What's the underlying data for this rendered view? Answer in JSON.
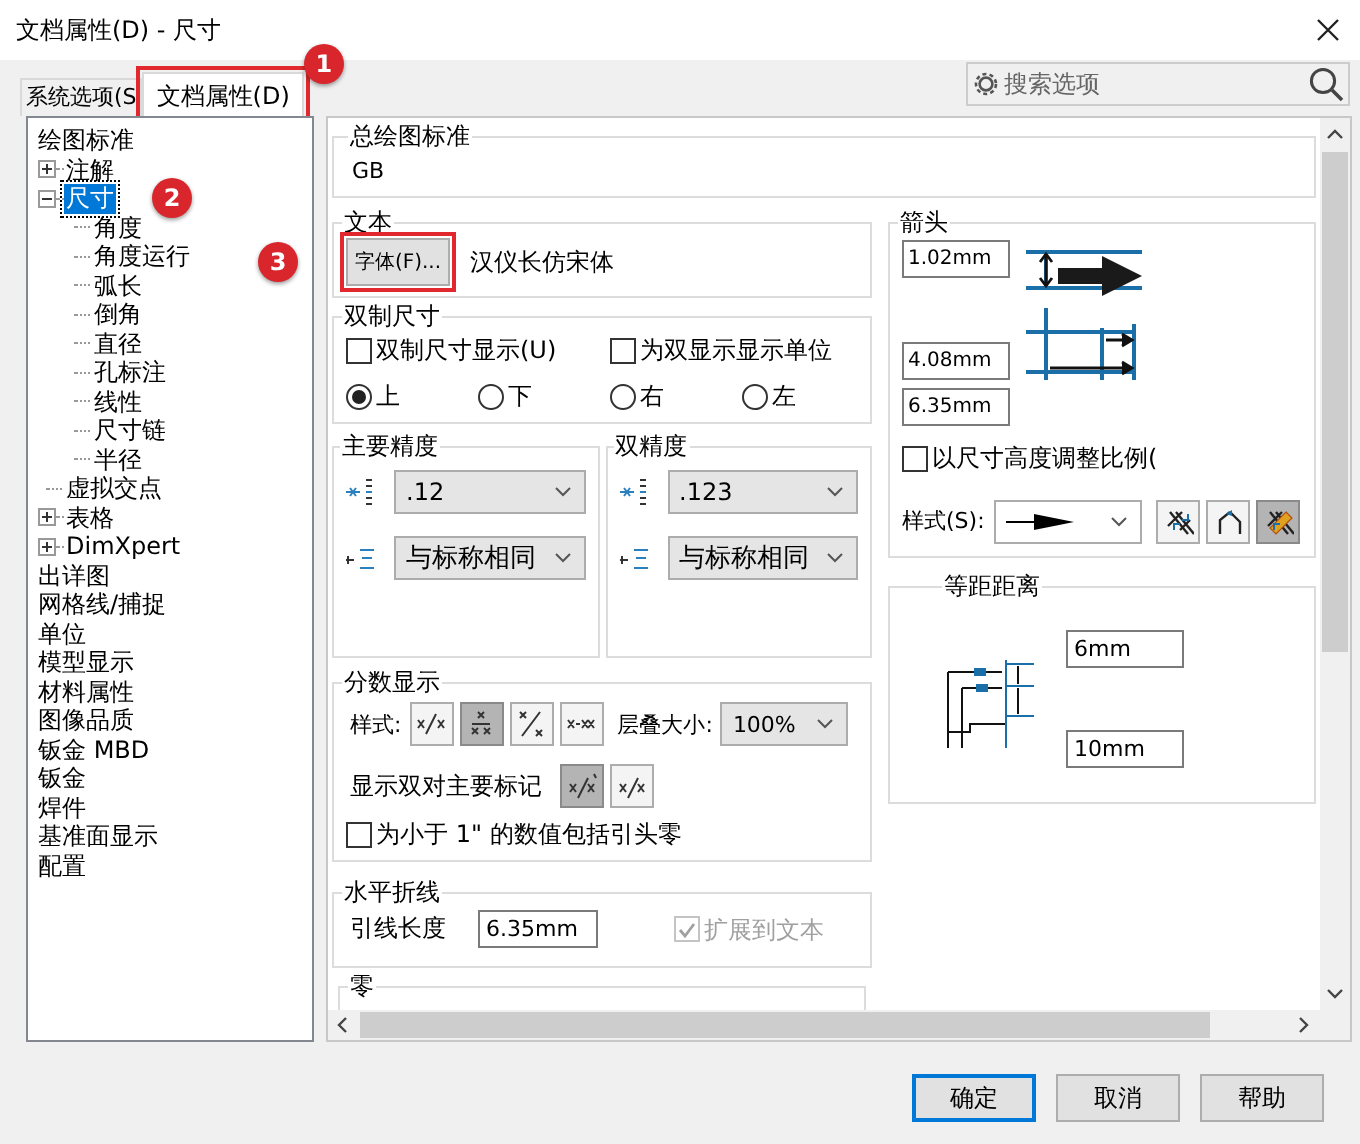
{
  "window": {
    "title": "文档属性(D) - 尺寸"
  },
  "tabs": [
    {
      "label": "系统选项(S",
      "selected": false
    },
    {
      "label": "文档属性(D)",
      "selected": true,
      "annotation": "1"
    }
  ],
  "search": {
    "placeholder": "搜索选项"
  },
  "tree": [
    {
      "label": "绘图标准",
      "selected": false,
      "children": [
        {
          "label": "注解",
          "selected": false,
          "expanded": false
        },
        {
          "label": "尺寸",
          "selected": true,
          "expanded": true,
          "annotation": "2",
          "children": [
            {
              "label": "角度",
              "selected": false
            },
            {
              "label": "角度运行",
              "selected": false
            },
            {
              "label": "弧长",
              "selected": false
            },
            {
              "label": "倒角",
              "selected": false
            },
            {
              "label": "直径",
              "selected": false
            },
            {
              "label": "孔标注",
              "selected": false
            },
            {
              "label": "线性",
              "selected": false
            },
            {
              "label": "尺寸链",
              "selected": false
            },
            {
              "label": "半径",
              "selected": false
            }
          ]
        },
        {
          "label": "虚拟交点",
          "selected": false
        },
        {
          "label": "表格",
          "selected": false,
          "expanded": false
        },
        {
          "label": "DimXpert",
          "selected": false,
          "expanded": false
        }
      ]
    },
    {
      "label": "出详图",
      "selected": false
    },
    {
      "label": "网格线/捕捉",
      "selected": false
    },
    {
      "label": "单位",
      "selected": false
    },
    {
      "label": "模型显示",
      "selected": false
    },
    {
      "label": "材料属性",
      "selected": false
    },
    {
      "label": "图像品质",
      "selected": false
    },
    {
      "label": "钣金 MBD",
      "selected": false
    },
    {
      "label": "钣金",
      "selected": false
    },
    {
      "label": "焊件",
      "selected": false
    },
    {
      "label": "基准面显示",
      "selected": false
    },
    {
      "label": "配置",
      "selected": false
    }
  ],
  "general_standard": {
    "title": "总绘图标准",
    "value": "GB"
  },
  "text": {
    "title": "文本",
    "font_button": "字体(F)...",
    "font_button_annotation": "3",
    "font_name": "汉仪长仿宋体"
  },
  "dual_dimension": {
    "title": "双制尺寸",
    "checkboxes": [
      {
        "label": "双制尺寸显示(U)",
        "checked": false
      },
      {
        "label": "为双显示显示单位",
        "checked": false
      }
    ],
    "positions": [
      {
        "label": "上",
        "selected": true
      },
      {
        "label": "下",
        "selected": false
      },
      {
        "label": "右",
        "selected": false
      },
      {
        "label": "左",
        "selected": false
      }
    ]
  },
  "primary_precision": {
    "title": "主要精度",
    "value_precision": ".12",
    "tolerance_precision": "与标称相同"
  },
  "dual_precision": {
    "title": "双精度",
    "value_precision": ".123",
    "tolerance_precision": "与标称相同"
  },
  "fraction": {
    "title": "分数显示",
    "style_label": "样式:",
    "styles": [
      {
        "kind": "inline",
        "selected": false
      },
      {
        "kind": "stacked",
        "selected": true
      },
      {
        "kind": "diagonal",
        "selected": false
      },
      {
        "kind": "spaced",
        "selected": false
      }
    ],
    "stack_size_label": "层叠大小:",
    "stack_size": "100%",
    "dual_marks_label": "显示双对主要标记",
    "dual_marks": [
      {
        "kind": "marked",
        "selected": true
      },
      {
        "kind": "plain",
        "selected": false
      }
    ],
    "leading_zero": {
      "label": "为小于 1\" 的数值包括引头零",
      "checked": false
    }
  },
  "bent_leader": {
    "title": "水平折线",
    "length_label": "引线长度",
    "length": "6.35mm",
    "extend": {
      "label": "扩展到文本",
      "checked": true,
      "disabled": true
    }
  },
  "zero": {
    "title": "零"
  },
  "arrows": {
    "title": "箭头",
    "size_1": "1.02mm",
    "size_2": "4.08mm",
    "size_3": "6.35mm",
    "scale": {
      "label": "以尺寸高度调整比例(",
      "checked": false
    },
    "style_label": "样式(S):",
    "placement": [
      {
        "kind": "inside",
        "selected": false
      },
      {
        "kind": "outside",
        "selected": false
      },
      {
        "kind": "smart",
        "selected": true
      }
    ]
  },
  "offset": {
    "title": "等距距离",
    "distance_1": "6mm",
    "distance_2": "10mm"
  },
  "buttons": [
    {
      "label": "确定",
      "default": true
    },
    {
      "label": "取消",
      "default": false
    },
    {
      "label": "帮助",
      "default": false
    }
  ]
}
